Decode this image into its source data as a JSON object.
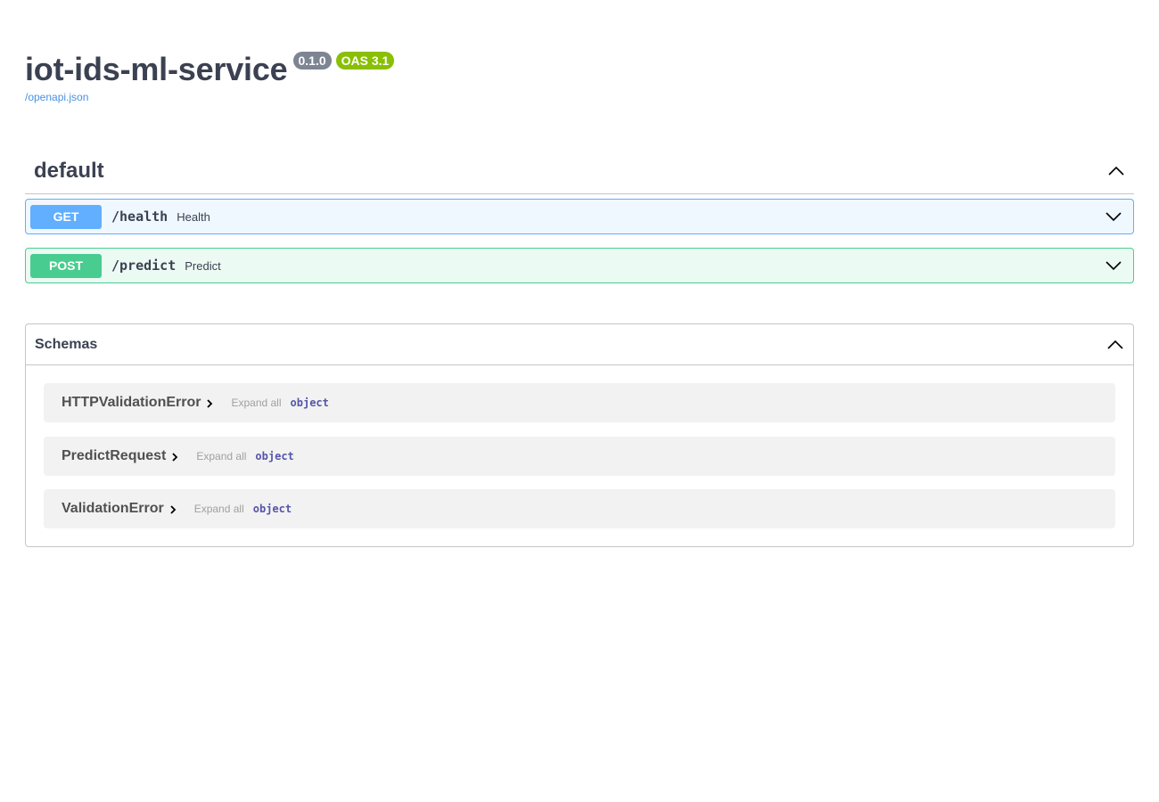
{
  "info": {
    "title": "iot-ids-ml-service",
    "version": "0.1.0",
    "oas": "OAS 3.1",
    "spec_link": "/openapi.json"
  },
  "tag": {
    "name": "default",
    "operations": [
      {
        "method": "GET",
        "path": "/health",
        "summary": "Health"
      },
      {
        "method": "POST",
        "path": "/predict",
        "summary": "Predict"
      }
    ]
  },
  "schemas": {
    "title": "Schemas",
    "models": [
      {
        "name": "HTTPValidationError",
        "expand_label": "Expand all",
        "type": "object"
      },
      {
        "name": "PredictRequest",
        "expand_label": "Expand all",
        "type": "object"
      },
      {
        "name": "ValidationError",
        "expand_label": "Expand all",
        "type": "object"
      }
    ]
  },
  "icons": {
    "collapse": "chevron-up-icon",
    "expand": "chevron-down-icon",
    "model_expand": "chevron-right-icon"
  },
  "colors": {
    "get": "#61affe",
    "post": "#49cc90",
    "version_badge": "#7d8492",
    "oas_badge": "#89bf04",
    "link": "#4990e2",
    "type": "#55a"
  }
}
